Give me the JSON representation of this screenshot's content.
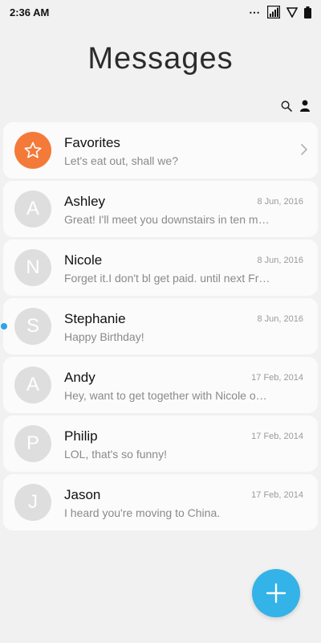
{
  "status_bar": {
    "time": "2:36 AM",
    "overflow": "⋯",
    "icons": [
      "signal-icon",
      "wifi-icon",
      "battery-icon"
    ]
  },
  "header": {
    "title": "Messages",
    "actions": [
      "search-icon",
      "contacts-icon"
    ]
  },
  "conversations": [
    {
      "name": "Favorites",
      "initial": "☆",
      "preview": "Let's eat out, shall we?",
      "date": "",
      "avatar_color": "#f47a3a",
      "is_favorites": true
    },
    {
      "name": "Ashley",
      "initial": "A",
      "preview": "Great! I'll meet you downstairs in ten min…",
      "date": "8 Jun, 2016"
    },
    {
      "name": "Nicole",
      "initial": "N",
      "preview": "Forget it.I don't bl get paid. until next Frid…",
      "date": "8 Jun, 2016"
    },
    {
      "name": "Stephanie",
      "initial": "S",
      "preview": "Happy Birthday!",
      "date": "8 Jun, 2016",
      "unread": true
    },
    {
      "name": "Andy",
      "initial": "A",
      "preview": "Hey, want to get together with Nicole on …",
      "date": "17 Feb, 2014"
    },
    {
      "name": "Philip",
      "initial": "P",
      "preview": "LOL, that's so funny!",
      "date": "17 Feb, 2014"
    },
    {
      "name": "Jason",
      "initial": "J",
      "preview": "I heard you're moving to China.",
      "date": "17 Feb, 2014"
    }
  ],
  "fab": {
    "icon": "plus-icon"
  },
  "colors": {
    "accent": "#33b3e8",
    "unread_dot": "#2aa4e6",
    "favorites": "#f47a3a"
  }
}
